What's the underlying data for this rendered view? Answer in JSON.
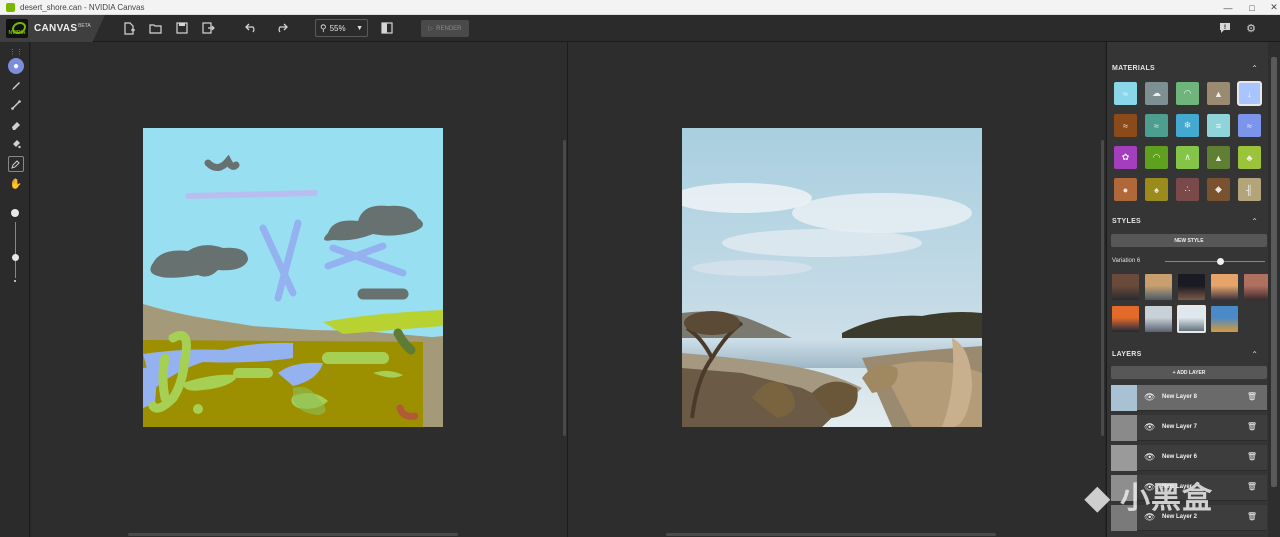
{
  "window": {
    "title": "desert_shore.can - NVIDIA Canvas",
    "controls": [
      "—",
      "□",
      "✕"
    ]
  },
  "brand": {
    "logo_text": "NVIDIA",
    "name": "CANVAS",
    "badge": "BETA"
  },
  "toolbar": {
    "zoom_value": "55%",
    "render_label": "RENDER"
  },
  "panels": {
    "materials": {
      "title": "MATERIALS",
      "items": [
        {
          "name": "water",
          "color": "#8ad7ea",
          "icon": "≈"
        },
        {
          "name": "cloud",
          "color": "#7d8f90",
          "icon": "☁"
        },
        {
          "name": "grass-hill",
          "color": "#6fb57b",
          "icon": "◠"
        },
        {
          "name": "mountain",
          "color": "#9a8a70",
          "icon": "▲"
        },
        {
          "name": "sky",
          "color": "#a9c4ff",
          "icon": "↓"
        },
        {
          "name": "dirt",
          "color": "#8a4a1a",
          "icon": "≈"
        },
        {
          "name": "sea",
          "color": "#4d9e8e",
          "icon": "≈"
        },
        {
          "name": "snow",
          "color": "#44a9d1",
          "icon": "❄"
        },
        {
          "name": "fog",
          "color": "#8fd4d8",
          "icon": "≡"
        },
        {
          "name": "river",
          "color": "#7c95ea",
          "icon": "≈"
        },
        {
          "name": "flower",
          "color": "#a33fbd",
          "icon": "✿"
        },
        {
          "name": "bush",
          "color": "#5fa01e",
          "icon": "◠"
        },
        {
          "name": "grass",
          "color": "#84c447",
          "icon": "∧"
        },
        {
          "name": "hill",
          "color": "#5f7f32",
          "icon": "▲"
        },
        {
          "name": "tree",
          "color": "#9bc43a",
          "icon": "♣"
        },
        {
          "name": "rock",
          "color": "#b0683a",
          "icon": "●"
        },
        {
          "name": "palm",
          "color": "#9b8b1a",
          "icon": "♠"
        },
        {
          "name": "sand",
          "color": "#7a4a4a",
          "icon": "∴"
        },
        {
          "name": "stone",
          "color": "#7a5230",
          "icon": "◆"
        },
        {
          "name": "building",
          "color": "#b3a47a",
          "icon": "╢"
        }
      ]
    },
    "styles": {
      "title": "STYLES",
      "new_style_label": "NEW STYLE",
      "variation_label": "Variation 6",
      "variation": 0.55,
      "thumbnails": [
        [
          "#6a4a3a",
          "#2a2a30"
        ],
        [
          "#c8a070",
          "#4a5a6a"
        ],
        [
          "#1a1a22",
          "#7a5a4a"
        ],
        [
          "#e6a46a",
          "#3a3040"
        ],
        [
          "#b07060",
          "#3a2a2a"
        ],
        [
          "#e46a2a",
          "#1a2a3a"
        ],
        [
          "#c8d0d8",
          "#5a6070"
        ],
        [
          "#dfe8ee",
          "#5a6a72"
        ],
        [
          "#4a8ac8",
          "#d89a3a"
        ]
      ]
    },
    "layers": {
      "title": "LAYERS",
      "add_label": "+ ADD LAYER",
      "items": [
        {
          "name": "New Layer 8",
          "thumb": "#a8c2d4"
        },
        {
          "name": "New Layer 7",
          "thumb": "#8a8a8a"
        },
        {
          "name": "New Layer 6",
          "thumb": "#9a9a9a"
        },
        {
          "name": "New Layer",
          "thumb": "#8e8e8e"
        },
        {
          "name": "New Layer 2",
          "thumb": "#7a7a7a"
        }
      ]
    }
  },
  "watermark": {
    "text": "小黑盒"
  },
  "colors": {
    "accent_tool": "#7b8ddb",
    "panel_bg": "#353535",
    "canvas_bg": "#2d2d2d"
  }
}
